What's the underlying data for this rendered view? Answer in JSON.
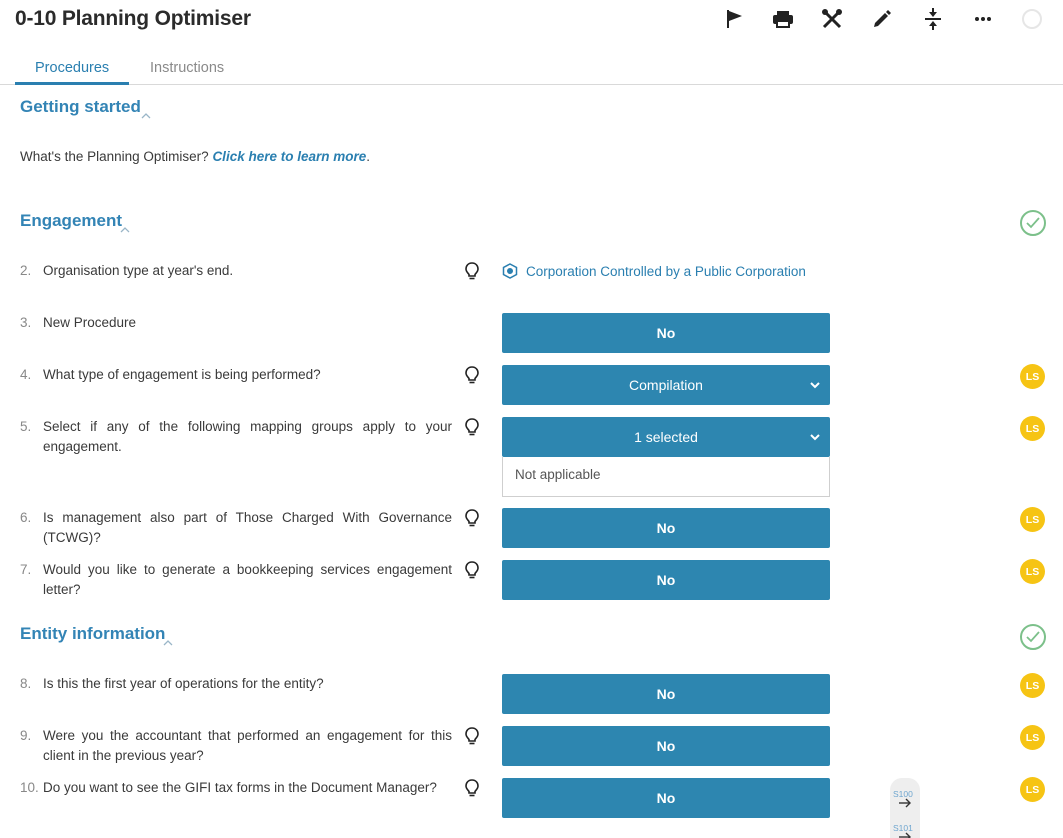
{
  "header": {
    "title": "0-10 Planning Optimiser",
    "tools": [
      "flag-icon",
      "print-icon",
      "tools-icon",
      "edit-icon",
      "collapse-icon",
      "more-icon"
    ]
  },
  "tabs": [
    {
      "label": "Procedures",
      "active": true
    },
    {
      "label": "Instructions",
      "active": false
    }
  ],
  "sections": {
    "getting_started": {
      "title": "Getting started",
      "intro": "What's the Planning Optimiser?",
      "link": "Click here to learn more",
      "link_suffix": "."
    },
    "engagement": {
      "title": "Engagement"
    },
    "entity": {
      "title": "Entity information"
    }
  },
  "questions": [
    {
      "num": "2.",
      "text": "Organisation type at year's end.",
      "answer": "Corporation Controlled by a Public Corporation"
    },
    {
      "num": "3.",
      "text": "New Procedure",
      "answer": "No"
    },
    {
      "num": "4.",
      "text": "What type of engagement is being performed?",
      "answer": "Compilation",
      "badge": "LS"
    },
    {
      "num": "5.",
      "text": "Select if any of the following mapping groups apply to your engagement.",
      "answer": "1 selected",
      "option": "Not applicable",
      "badge": "LS"
    },
    {
      "num": "6.",
      "text": "Is management also part of Those Charged With Governance (TCWG)?",
      "answer": "No",
      "badge": "LS"
    },
    {
      "num": "7.",
      "text": "Would you like to generate a bookkeeping services engagement letter?",
      "answer": "No",
      "badge": "LS"
    },
    {
      "num": "8.",
      "text": "Is this the first year of operations for the entity?",
      "answer": "No",
      "badge": "LS"
    },
    {
      "num": "9.",
      "text": "Were you the accountant that performed an engagement for this client in the previous year?",
      "answer": "No",
      "badge": "LS"
    },
    {
      "num": "10.",
      "text": "Do you want to see the GIFI tax forms in the Document Manager?",
      "answer": "No",
      "badge": "LS"
    }
  ],
  "nav": {
    "prev": "S100",
    "next": "S101"
  },
  "colors": {
    "accent": "#2d86b0",
    "link": "#2a7fb0",
    "badge": "#f6c414",
    "check": "#7cc08a"
  }
}
